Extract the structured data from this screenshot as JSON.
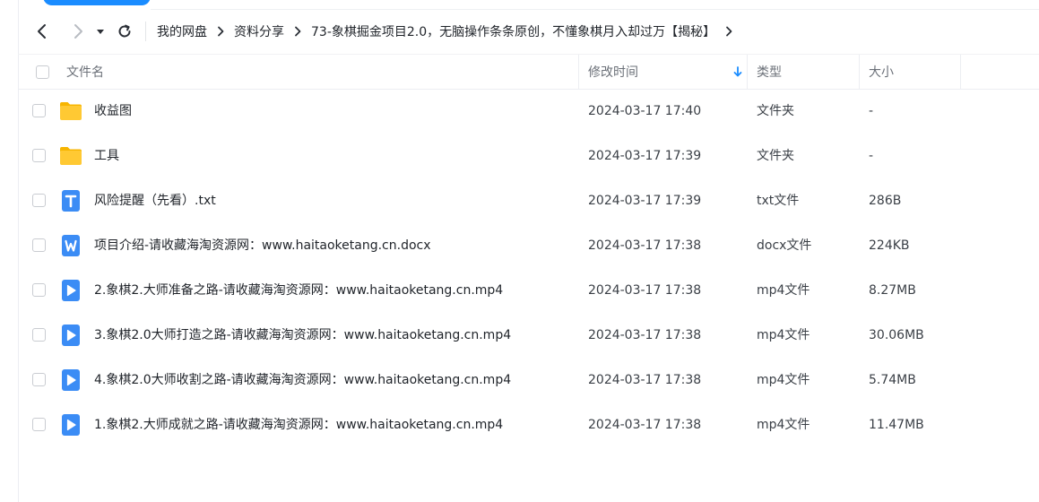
{
  "nav": {
    "breadcrumb": [
      "我的网盘",
      "资料分享",
      "73-象棋掘金项目2.0，无脑操作条条原创，不懂象棋月入却过万【揭秘】"
    ]
  },
  "table": {
    "columns": {
      "name": "文件名",
      "modified": "修改时间",
      "type": "类型",
      "size": "大小"
    },
    "sort": "modified-desc",
    "rows": [
      {
        "name": "收益图",
        "modified": "2024-03-17 17:40",
        "type": "文件夹",
        "size": "-",
        "icon": "folder-icon"
      },
      {
        "name": "工具",
        "modified": "2024-03-17 17:39",
        "type": "文件夹",
        "size": "-",
        "icon": "folder-icon"
      },
      {
        "name": "风险提醒（先看）.txt",
        "modified": "2024-03-17 17:39",
        "type": "txt文件",
        "size": "286B",
        "icon": "txt-file-icon"
      },
      {
        "name": "项目介绍-请收藏海淘资源网：www.haitaoketang.cn.docx",
        "modified": "2024-03-17 17:38",
        "type": "docx文件",
        "size": "224KB",
        "icon": "word-file-icon"
      },
      {
        "name": "2.象棋2.大师准备之路-请收藏海淘资源网：www.haitaoketang.cn.mp4",
        "modified": "2024-03-17 17:38",
        "type": "mp4文件",
        "size": "8.27MB",
        "icon": "video-file-icon"
      },
      {
        "name": "3.象棋2.0大师打造之路-请收藏海淘资源网：www.haitaoketang.cn.mp4",
        "modified": "2024-03-17 17:38",
        "type": "mp4文件",
        "size": "30.06MB",
        "icon": "video-file-icon"
      },
      {
        "name": "4.象棋2.0大师收割之路-请收藏海淘资源网：www.haitaoketang.cn.mp4",
        "modified": "2024-03-17 17:38",
        "type": "mp4文件",
        "size": "5.74MB",
        "icon": "video-file-icon"
      },
      {
        "name": "1.象棋2.大师成就之路-请收藏海淘资源网：www.haitaoketang.cn.mp4",
        "modified": "2024-03-17 17:38",
        "type": "mp4文件",
        "size": "11.47MB",
        "icon": "video-file-icon"
      }
    ]
  },
  "colors": {
    "accent": "#1a8cff",
    "folder": "#ffc933",
    "file_blue": "#3b8cf5"
  }
}
